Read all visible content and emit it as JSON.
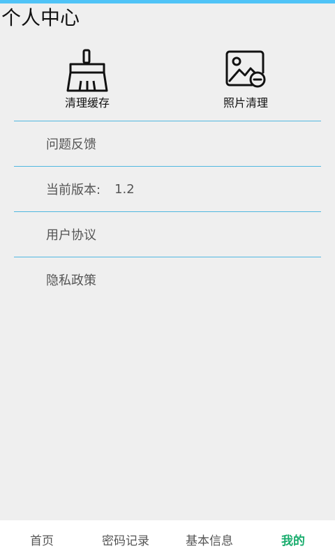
{
  "header": {
    "title": "个人中心"
  },
  "tools": [
    {
      "label": "清理缓存",
      "icon": "broom-icon"
    },
    {
      "label": "照片清理",
      "icon": "photo-delete-icon"
    }
  ],
  "menu": {
    "feedback": "问题反馈",
    "version_label": "当前版本:",
    "version_value": "1.2",
    "agreement": "用户协议",
    "privacy": "隐私政策"
  },
  "nav": {
    "items": [
      "首页",
      "密码记录",
      "基本信息",
      "我的"
    ],
    "active": "我的"
  },
  "colors": {
    "accent_bar": "#4fc3f7",
    "divider": "#4fb7e0",
    "active_tab": "#1aad6e"
  }
}
